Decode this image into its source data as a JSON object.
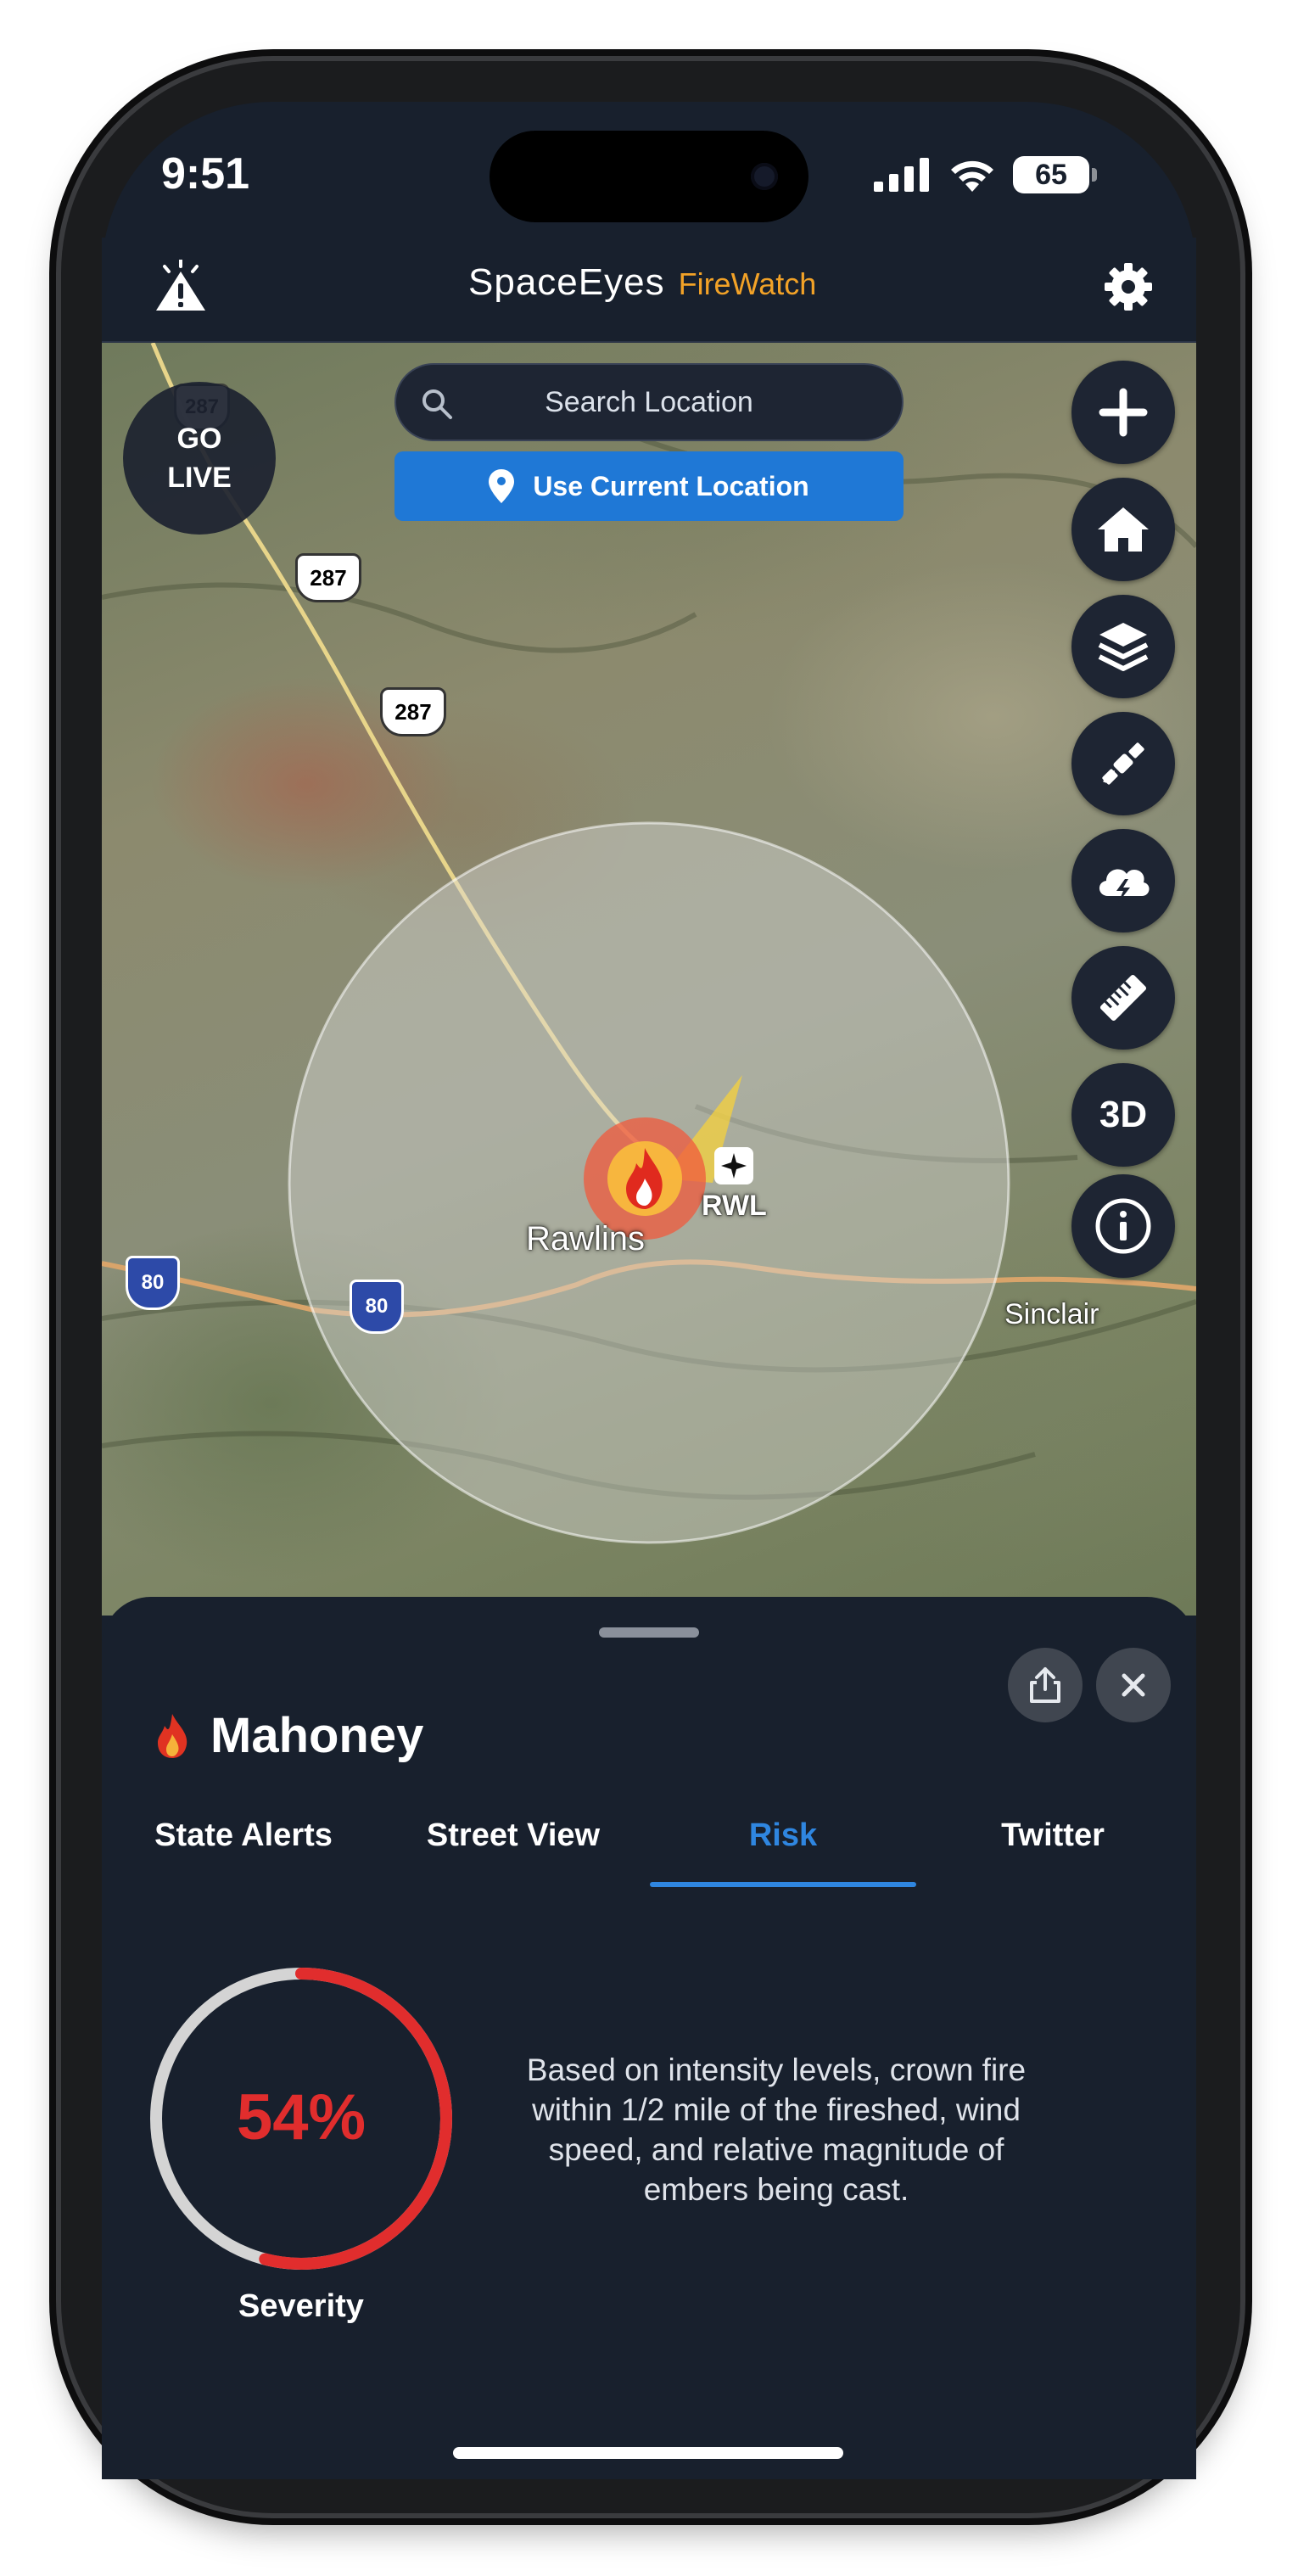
{
  "status": {
    "time": "9:51",
    "battery": "65"
  },
  "header": {
    "brand_space": "SpaceEyes",
    "brand_fw": "FireWatch",
    "alert_icon": "warning-icon",
    "settings_icon": "gear-icon"
  },
  "map": {
    "go_live": [
      "GO",
      "LIVE"
    ],
    "search_placeholder": "Search Location",
    "use_current_location": "Use Current Location",
    "labels": {
      "rawlins": "Rawlins",
      "rwl": "RWL",
      "sinclair": "Sinclair"
    },
    "shields": {
      "us287_a": "287",
      "us287_b": "287",
      "us287_c": "287",
      "i80_a": "80",
      "i80_b": "80"
    },
    "controls": [
      "plus-icon",
      "home-icon",
      "layers-icon",
      "satellite-icon",
      "storm-cloud-icon",
      "ruler-icon",
      "3D",
      "info-icon"
    ],
    "control_3d": "3D"
  },
  "sheet": {
    "title": "Mahoney",
    "tabs": [
      "State Alerts",
      "Street View",
      "Risk",
      "Twitter"
    ],
    "active_tab": "Risk",
    "severity": {
      "value_text": "54%",
      "value": 0.54,
      "label": "Severity"
    },
    "description": "Based on intensity levels, crown fire within 1/2 mile of the fireshed, wind speed, and relative magnitude of embers being cast."
  },
  "colors": {
    "accent_blue": "#1f78d6",
    "fire_red": "#e12d2d",
    "brand_orange": "#f2a227",
    "panel": "#18202d"
  }
}
